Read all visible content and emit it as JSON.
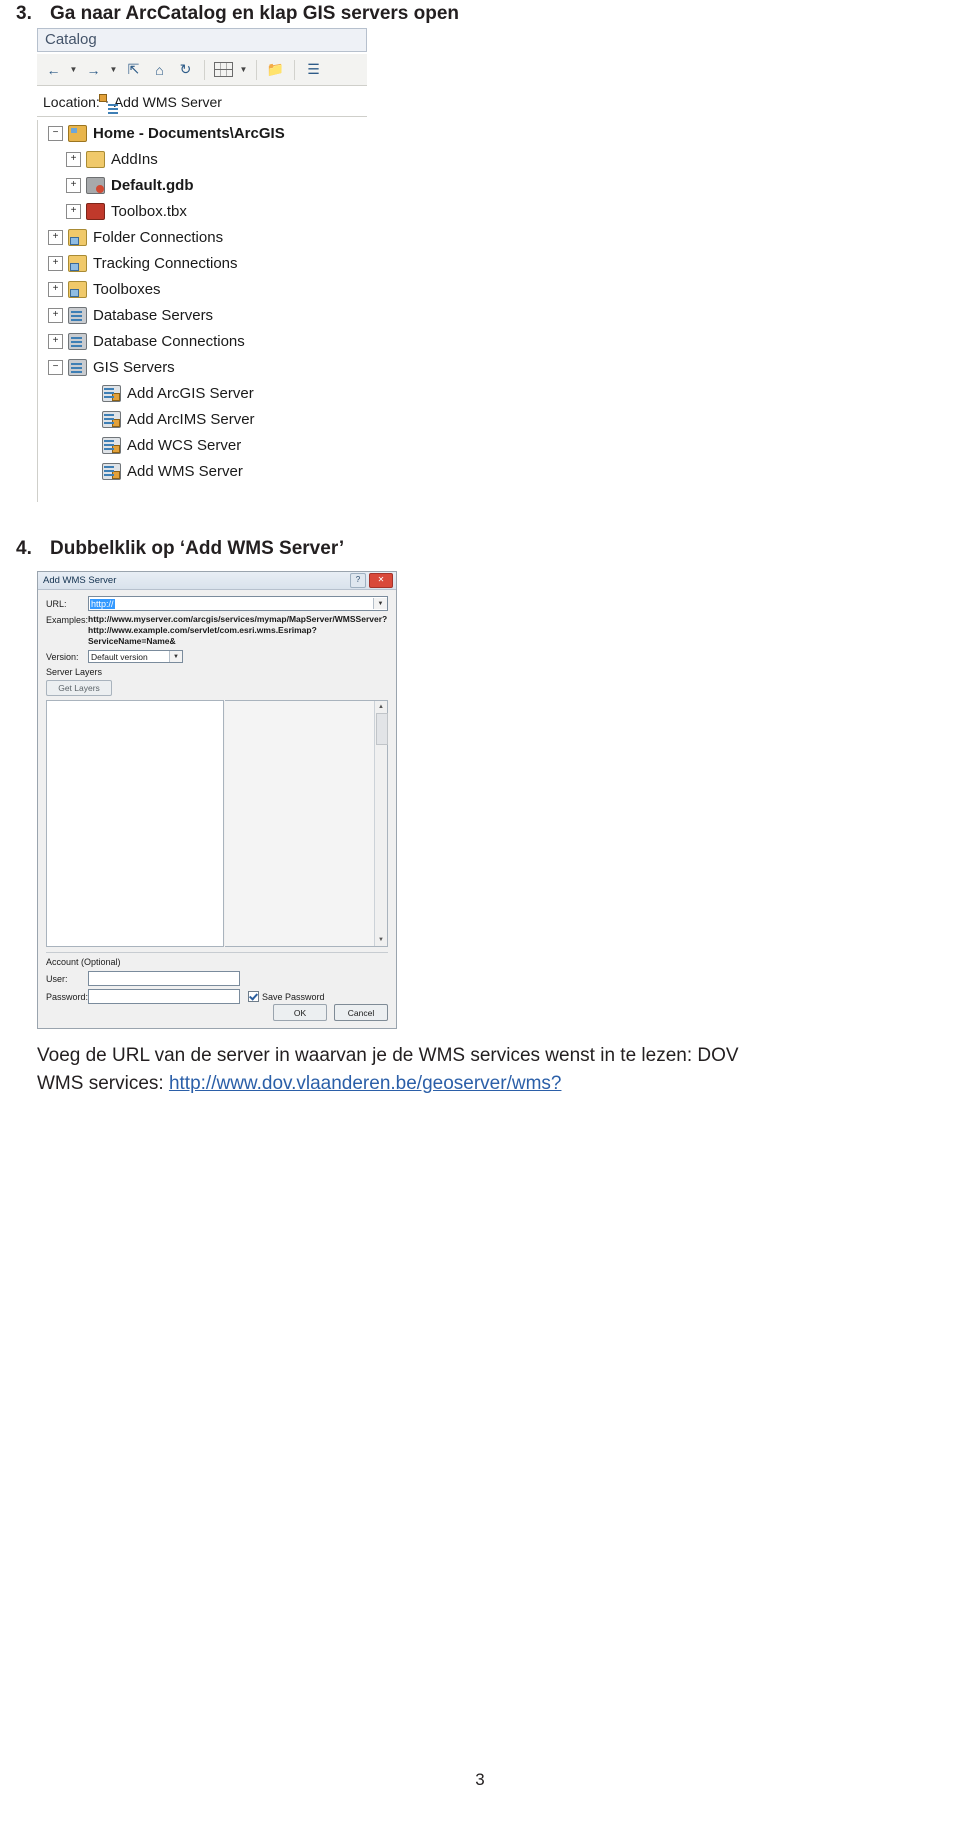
{
  "steps": {
    "step3": {
      "num": "3.",
      "text": "Ga naar ArcCatalog en klap GIS servers open"
    },
    "step4": {
      "num": "4.",
      "text": "Dubbelklik op ‘Add WMS Server’"
    }
  },
  "catalog": {
    "title": "Catalog",
    "toolbar": {
      "back_icon": "back-arrow-icon",
      "forward_icon": "forward-arrow-icon",
      "up_icon": "up-one-level-icon",
      "home_icon": "home-icon",
      "refresh_icon": "refresh-icon",
      "views_icon": "list-view-icon",
      "connect_icon": "connect-folder-icon",
      "organize_icon": "organize-icon"
    },
    "location": {
      "label": "Location:",
      "value": "Add WMS Server",
      "icon": "add-wms-server-icon"
    },
    "tree": [
      {
        "label": "Home - Documents\\ArcGIS",
        "expander": "−",
        "icon": "home-folder-icon",
        "indent": 0,
        "bold": true
      },
      {
        "label": "AddIns",
        "expander": "+",
        "icon": "folder-icon",
        "indent": 1,
        "bold": false
      },
      {
        "label": "Default.gdb",
        "expander": "+",
        "icon": "geodatabase-icon",
        "indent": 1,
        "bold": true
      },
      {
        "label": "Toolbox.tbx",
        "expander": "+",
        "icon": "toolbox-icon",
        "indent": 1,
        "bold": false
      },
      {
        "label": "Folder Connections",
        "expander": "+",
        "icon": "folder-connection-icon",
        "indent": 0,
        "bold": false
      },
      {
        "label": "Tracking Connections",
        "expander": "+",
        "icon": "tracking-connection-icon",
        "indent": 0,
        "bold": false
      },
      {
        "label": "Toolboxes",
        "expander": "+",
        "icon": "toolboxes-icon",
        "indent": 0,
        "bold": false
      },
      {
        "label": "Database Servers",
        "expander": "+",
        "icon": "database-server-icon",
        "indent": 0,
        "bold": false
      },
      {
        "label": "Database Connections",
        "expander": "+",
        "icon": "database-connection-icon",
        "indent": 0,
        "bold": false
      },
      {
        "label": "GIS Servers",
        "expander": "−",
        "icon": "gis-servers-icon",
        "indent": 0,
        "bold": false
      },
      {
        "label": "Add ArcGIS Server",
        "expander": "",
        "icon": "add-arcgis-server-icon",
        "indent": 2,
        "bold": false
      },
      {
        "label": "Add ArcIMS Server",
        "expander": "",
        "icon": "add-arcims-server-icon",
        "indent": 2,
        "bold": false
      },
      {
        "label": "Add WCS Server",
        "expander": "",
        "icon": "add-wcs-server-icon",
        "indent": 2,
        "bold": false
      },
      {
        "label": "Add WMS Server",
        "expander": "",
        "icon": "add-wms-server-icon",
        "indent": 2,
        "bold": false
      }
    ]
  },
  "dialog": {
    "title": "Add WMS Server",
    "help_label": "?",
    "close_label": "✕",
    "url_label": "URL:",
    "url_value": "http://",
    "examples_label": "Examples:",
    "examples": [
      "http://www.myserver.com/arcgis/services/mymap/MapServer/WMSServer?",
      "http://www.example.com/servlet/com.esri.wms.Esrimap?ServiceName=Name&"
    ],
    "version_label": "Version:",
    "version_value": "Default version",
    "server_layers_label": "Server Layers",
    "get_layers_label": "Get Layers",
    "account_label": "Account (Optional)",
    "user_label": "User:",
    "user_value": "",
    "password_label": "Password:",
    "password_value": "",
    "save_password_label": "Save Password",
    "save_password_checked": true,
    "ok_label": "OK",
    "cancel_label": "Cancel"
  },
  "paragraph": {
    "line1": "Voeg de URL van de server in waarvan je de WMS services wenst in te lezen: DOV",
    "line2_prefix": "WMS services: ",
    "link_text": "http://www.dov.vlaanderen.be/geoserver/wms?"
  },
  "page_number": "3"
}
